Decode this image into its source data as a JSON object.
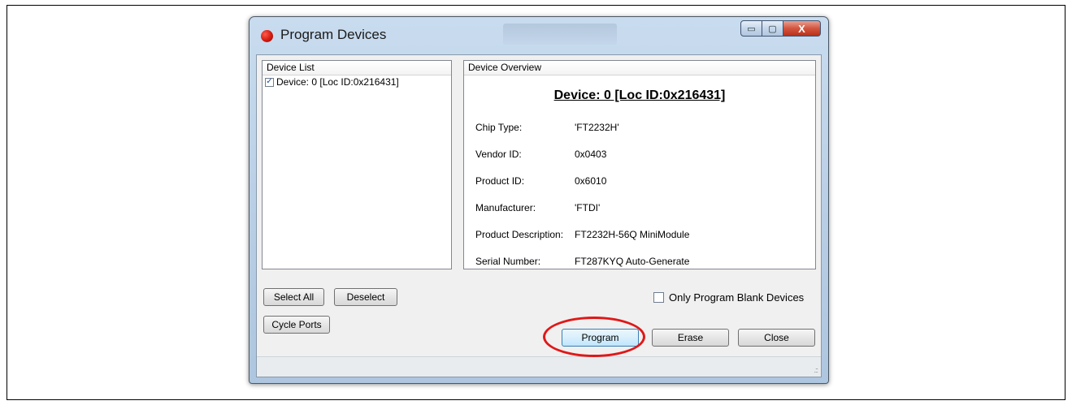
{
  "window": {
    "title": "Program Devices",
    "controls": {
      "minimize": "▭",
      "maximize": "▢",
      "close": "X"
    }
  },
  "device_list": {
    "header": "Device List",
    "items": [
      {
        "label": "Device: 0 [Loc ID:0x216431]",
        "checked": "✓"
      }
    ]
  },
  "device_overview": {
    "header": "Device Overview",
    "heading": "Device: 0 [Loc ID:0x216431]",
    "rows": [
      {
        "label": "Chip Type:",
        "value": "'FT2232H'"
      },
      {
        "label": "Vendor ID:",
        "value": "0x0403"
      },
      {
        "label": "Product ID:",
        "value": "0x6010"
      },
      {
        "label": "Manufacturer:",
        "value": "'FTDI'"
      },
      {
        "label": "Product Description:",
        "value": "FT2232H-56Q MiniModule"
      },
      {
        "label": "Serial Number:",
        "value": "FT287KYQ Auto-Generate"
      }
    ]
  },
  "buttons": {
    "select_all": "Select All",
    "deselect": "Deselect",
    "cycle_ports": "Cycle Ports",
    "program": "Program",
    "erase": "Erase",
    "close": "Close"
  },
  "only_blank": {
    "label": "Only Program Blank Devices",
    "checked": ""
  },
  "statusbar": {
    "grip": ".::"
  },
  "colors": {
    "highlight": "#e01818",
    "title_icon": "#d11a10"
  }
}
